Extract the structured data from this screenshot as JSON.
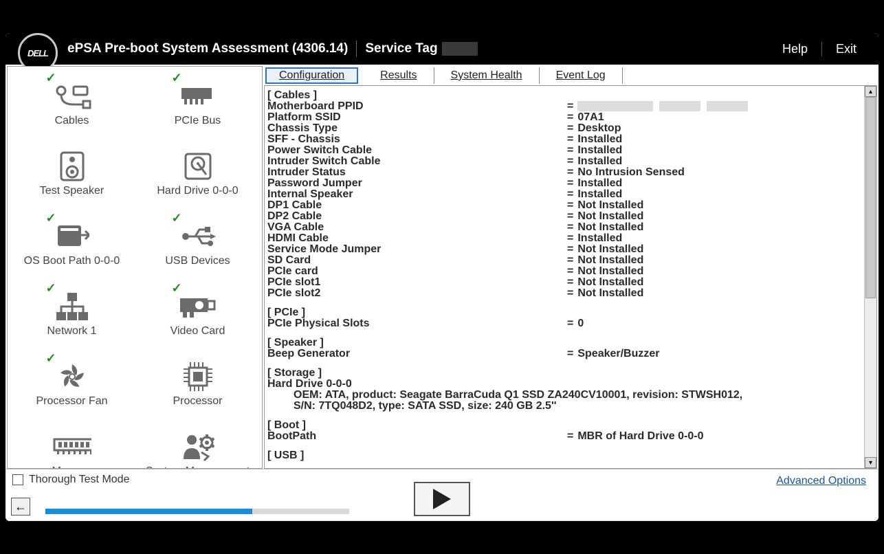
{
  "header": {
    "logo_text": "DELL",
    "title": "ePSA Pre-boot System Assessment (4306.14)",
    "service_tag_label": "Service Tag",
    "help": "Help",
    "exit": "Exit"
  },
  "devices": [
    {
      "label": "Cables",
      "checked": true,
      "icon": "cables"
    },
    {
      "label": "PCIe Bus",
      "checked": true,
      "icon": "pcie"
    },
    {
      "label": "Test Speaker",
      "checked": false,
      "icon": "speaker"
    },
    {
      "label": "Hard Drive 0-0-0",
      "checked": false,
      "icon": "hdd"
    },
    {
      "label": "OS Boot Path 0-0-0",
      "checked": true,
      "icon": "boot"
    },
    {
      "label": "USB Devices",
      "checked": true,
      "icon": "usb"
    },
    {
      "label": "Network 1",
      "checked": true,
      "icon": "network"
    },
    {
      "label": "Video Card",
      "checked": true,
      "icon": "video"
    },
    {
      "label": "Processor Fan",
      "checked": true,
      "icon": "fan"
    },
    {
      "label": "Processor",
      "checked": false,
      "icon": "cpu"
    },
    {
      "label": "Memory",
      "checked": false,
      "icon": "memory"
    },
    {
      "label": "System Management",
      "checked": false,
      "icon": "sysmgmt"
    }
  ],
  "tabs": [
    "Configuration",
    "Results",
    "System Health",
    "Event Log"
  ],
  "active_tab": 0,
  "config": {
    "sections": [
      {
        "title": "[ Cables ]",
        "rows": [
          {
            "label": "Motherboard PPID",
            "value": "",
            "redacted": true
          },
          {
            "label": "Platform SSID",
            "value": "07A1"
          },
          {
            "label": "Chassis Type",
            "value": "Desktop"
          },
          {
            "label": "SFF - Chassis",
            "value": "Installed"
          },
          {
            "label": "Power Switch Cable",
            "value": "Installed"
          },
          {
            "label": "Intruder Switch Cable",
            "value": "Installed"
          },
          {
            "label": "Intruder Status",
            "value": "No Intrusion Sensed"
          },
          {
            "label": "Password Jumper",
            "value": "Installed"
          },
          {
            "label": "Internal Speaker",
            "value": "Installed"
          },
          {
            "label": "DP1 Cable",
            "value": "Not Installed"
          },
          {
            "label": "DP2 Cable",
            "value": "Not Installed"
          },
          {
            "label": "VGA Cable",
            "value": "Not Installed"
          },
          {
            "label": "HDMI Cable",
            "value": "Installed"
          },
          {
            "label": "Service Mode Jumper",
            "value": "Not Installed"
          },
          {
            "label": "SD Card",
            "value": "Not Installed"
          },
          {
            "label": "PCIe card",
            "value": "Not Installed"
          },
          {
            "label": "PCIe slot1",
            "value": "Not Installed"
          },
          {
            "label": "PCIe slot2",
            "value": "Not Installed"
          }
        ]
      },
      {
        "title": "[ PCIe ]",
        "rows": [
          {
            "label": "PCIe Physical Slots",
            "value": "0"
          }
        ]
      },
      {
        "title": "[ Speaker ]",
        "rows": [
          {
            "label": "Beep Generator",
            "value": "Speaker/Buzzer"
          }
        ]
      },
      {
        "title": "[ Storage ]",
        "plain": [
          "Hard Drive 0-0-0",
          "OEM: ATA, product: Seagate BarraCuda Q1 SSD ZA240CV10001, revision: STWSH012,",
          "S/N: 7TQ048D2, type: SATA SSD, size: 240 GB 2.5''"
        ]
      },
      {
        "title": "[ Boot ]",
        "rows": [
          {
            "label": "BootPath",
            "value": "MBR of Hard Drive 0-0-0"
          }
        ]
      },
      {
        "title": "[ USB ]",
        "rows": []
      }
    ]
  },
  "footer": {
    "thorough": "Thorough Test Mode",
    "advanced": "Advanced Options",
    "progress_percent": 68
  }
}
